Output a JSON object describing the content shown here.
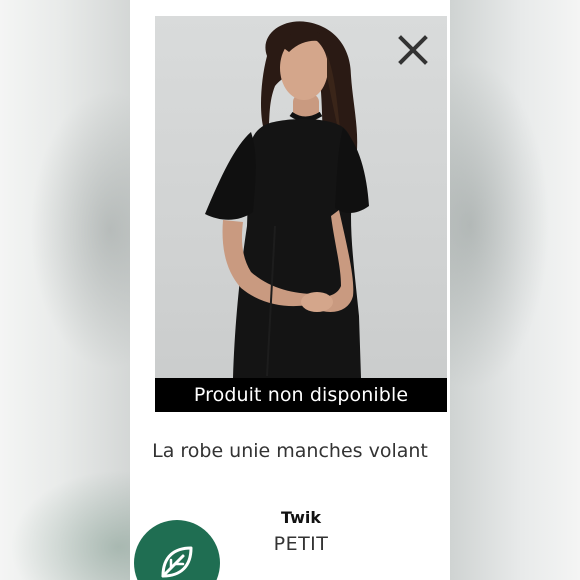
{
  "banner": {
    "unavailable_label": "Produit non disponible"
  },
  "product": {
    "name": "La robe unie manches volant",
    "brand": "Twik",
    "size": "PETIT"
  },
  "icons": {
    "close": "close-icon",
    "eco": "leaf-icon"
  },
  "colors": {
    "banner_bg": "#000000",
    "banner_text": "#ffffff",
    "eco_badge": "#1f6e52",
    "photo_bg": "#d3d5d5"
  }
}
